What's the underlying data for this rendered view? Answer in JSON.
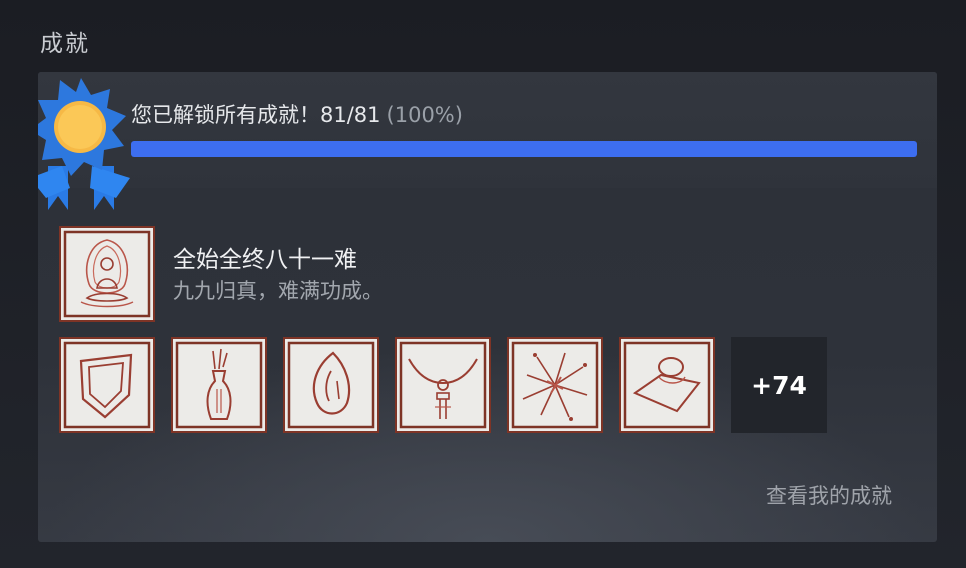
{
  "section": {
    "title": "成就"
  },
  "summary": {
    "text": "您已解锁所有成就！81/81",
    "percent_text": "(100%)",
    "unlocked": 81,
    "total": 81,
    "progress_fraction": 1.0,
    "progress_color": "#3d6ef0"
  },
  "featured": {
    "name": "全始全终八十一难",
    "description": "九九归真，难满功成。",
    "icon": "seated-buddha-icon"
  },
  "tiles": [
    {
      "icon": "shield-icon"
    },
    {
      "icon": "vase-icon"
    },
    {
      "icon": "gourd-seed-icon"
    },
    {
      "icon": "pendant-necklace-icon"
    },
    {
      "icon": "burst-sparks-icon"
    },
    {
      "icon": "ring-cushion-icon"
    }
  ],
  "more": {
    "label": "+74"
  },
  "view_link": {
    "label": "查看我的成就"
  },
  "colors": {
    "tile_border": "#7e3426",
    "tile_bg": "#ecebe8",
    "badge_blue": "#2d7ae0",
    "badge_gold": "#f7be4c"
  }
}
